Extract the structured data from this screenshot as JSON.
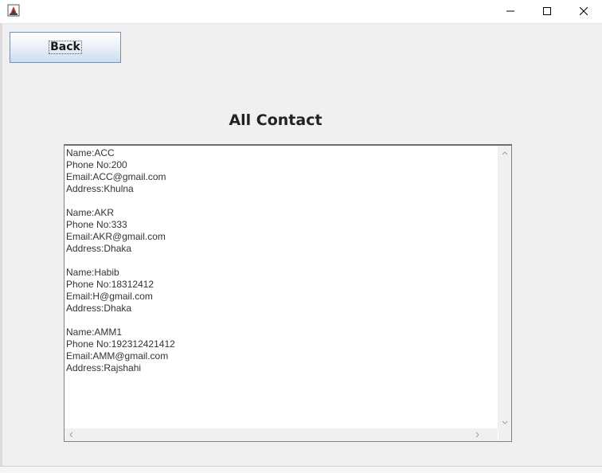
{
  "window": {
    "app_icon": "java-cup-icon",
    "controls": {
      "minimize": "minimize-icon",
      "maximize": "maximize-icon",
      "close": "close-icon"
    }
  },
  "toolbar": {
    "back_label": "Back"
  },
  "page": {
    "title": "All Contact"
  },
  "contacts": [
    {
      "name": "Name:ACC",
      "phone": "Phone No:200",
      "email": "Email:ACC@gmail.com",
      "address": "Address:Khulna"
    },
    {
      "name": "Name:AKR",
      "phone": "Phone No:333",
      "email": "Email:AKR@gmail.com",
      "address": "Address:Dhaka"
    },
    {
      "name": "Name:Habib",
      "phone": "Phone No:18312412",
      "email": "Email:H@gmail.com",
      "address": "Address:Dhaka"
    },
    {
      "name": "Name:AMM1",
      "phone": "Phone No:192312421412",
      "email": "Email:AMM@gmail.com",
      "address": "Address:Rajshahi"
    }
  ],
  "colors": {
    "client_background": "#f0f0f0",
    "button_border": "#7a8ea8",
    "button_gradient_bottom": "#cddced"
  }
}
